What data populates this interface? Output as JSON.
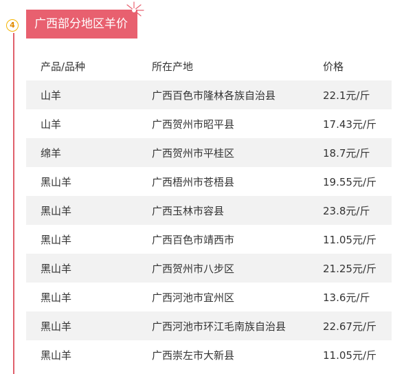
{
  "section": {
    "number": "4",
    "title": "广西部分地区羊价"
  },
  "table": {
    "headers": [
      "产品/品种",
      "所在产地",
      "价格"
    ],
    "rows": [
      [
        "山羊",
        "广西百色市隆林各族自治县",
        "22.1元/斤"
      ],
      [
        "山羊",
        "广西贺州市昭平县",
        "17.43元/斤"
      ],
      [
        "绵羊",
        "广西贺州市平桂区",
        "18.7元/斤"
      ],
      [
        "黑山羊",
        "广西梧州市苍梧县",
        "19.55元/斤"
      ],
      [
        "黑山羊",
        "广西玉林市容县",
        "23.8元/斤"
      ],
      [
        "黑山羊",
        "广西百色市靖西市",
        "11.05元/斤"
      ],
      [
        "黑山羊",
        "广西贺州市八步区",
        "21.25元/斤"
      ],
      [
        "黑山羊",
        "广西河池市宜州区",
        "13.6元/斤"
      ],
      [
        "黑山羊",
        "广西河池市环江毛南族自治县",
        "22.67元/斤"
      ],
      [
        "黑山羊",
        "广西崇左市大新县",
        "11.05元/斤"
      ]
    ]
  },
  "colors": {
    "accent": "#e8606f",
    "badge": "#f5b400",
    "row_alt": "#f2f2f2"
  },
  "icons": {
    "decoration": "firework-icon"
  }
}
